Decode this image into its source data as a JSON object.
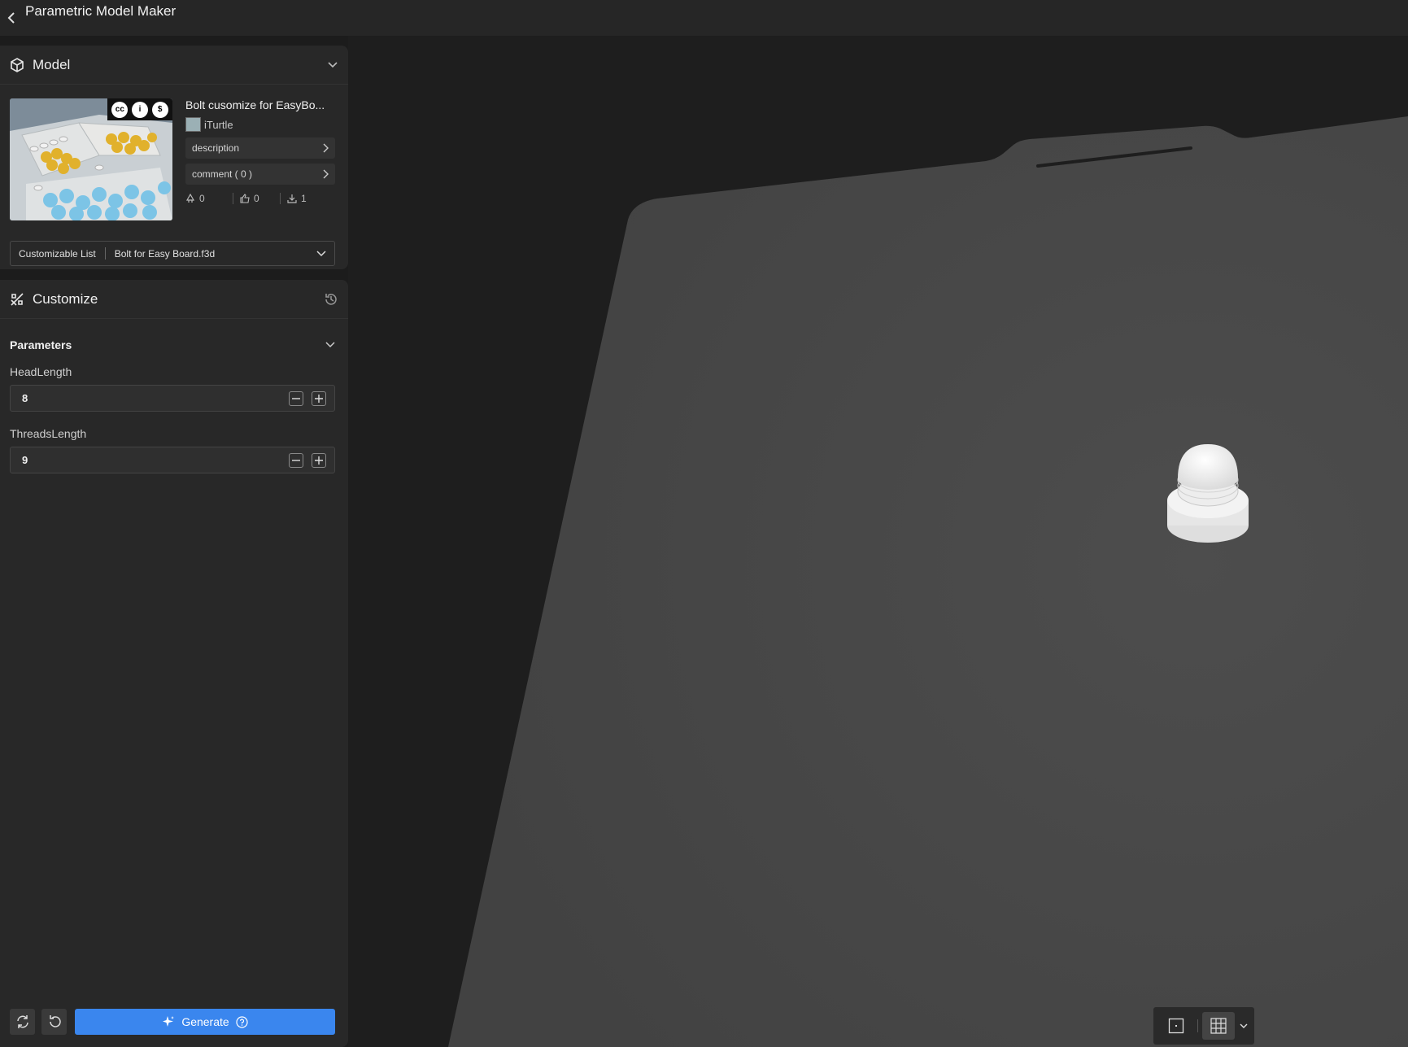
{
  "app": {
    "title": "Parametric Model Maker"
  },
  "model_panel": {
    "heading": "Model",
    "model_name": "Bolt cusomize for EasyBo...",
    "author": "iTurtle",
    "license_badges": [
      "cc",
      "i",
      "$"
    ],
    "license_text": [
      "BY",
      "NC"
    ],
    "description_label": "description",
    "comment_label": "comment ( 0 )",
    "stats": {
      "boosts": "0",
      "likes": "0",
      "downloads": "1"
    },
    "customizable_list_label": "Customizable List",
    "selected_file": "Bolt for Easy Board.f3d"
  },
  "customize_panel": {
    "heading": "Customize",
    "parameters_heading": "Parameters",
    "params": [
      {
        "label": "HeadLength",
        "value": "8"
      },
      {
        "label": "ThreadsLength",
        "value": "9"
      }
    ],
    "generate_label": "Generate"
  },
  "colors": {
    "accent": "#3a86ee",
    "panel": "#282828",
    "plate": "#484848"
  }
}
